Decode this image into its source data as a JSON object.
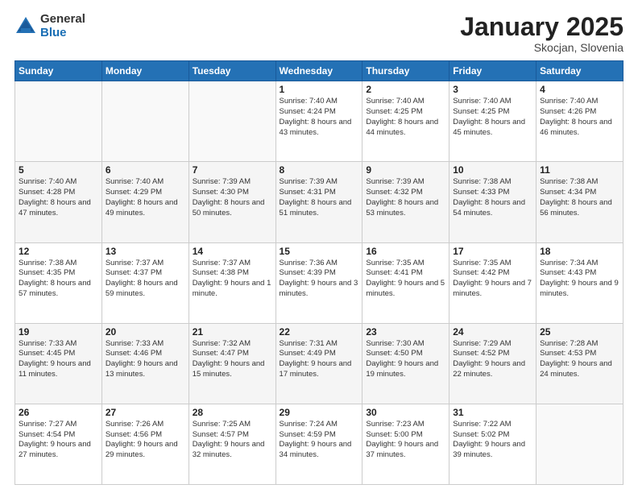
{
  "logo": {
    "general": "General",
    "blue": "Blue"
  },
  "header": {
    "month": "January 2025",
    "location": "Skocjan, Slovenia"
  },
  "weekdays": [
    "Sunday",
    "Monday",
    "Tuesday",
    "Wednesday",
    "Thursday",
    "Friday",
    "Saturday"
  ],
  "weeks": [
    [
      {
        "day": "",
        "info": ""
      },
      {
        "day": "",
        "info": ""
      },
      {
        "day": "",
        "info": ""
      },
      {
        "day": "1",
        "info": "Sunrise: 7:40 AM\nSunset: 4:24 PM\nDaylight: 8 hours and 43 minutes."
      },
      {
        "day": "2",
        "info": "Sunrise: 7:40 AM\nSunset: 4:25 PM\nDaylight: 8 hours and 44 minutes."
      },
      {
        "day": "3",
        "info": "Sunrise: 7:40 AM\nSunset: 4:25 PM\nDaylight: 8 hours and 45 minutes."
      },
      {
        "day": "4",
        "info": "Sunrise: 7:40 AM\nSunset: 4:26 PM\nDaylight: 8 hours and 46 minutes."
      }
    ],
    [
      {
        "day": "5",
        "info": "Sunrise: 7:40 AM\nSunset: 4:28 PM\nDaylight: 8 hours and 47 minutes."
      },
      {
        "day": "6",
        "info": "Sunrise: 7:40 AM\nSunset: 4:29 PM\nDaylight: 8 hours and 49 minutes."
      },
      {
        "day": "7",
        "info": "Sunrise: 7:39 AM\nSunset: 4:30 PM\nDaylight: 8 hours and 50 minutes."
      },
      {
        "day": "8",
        "info": "Sunrise: 7:39 AM\nSunset: 4:31 PM\nDaylight: 8 hours and 51 minutes."
      },
      {
        "day": "9",
        "info": "Sunrise: 7:39 AM\nSunset: 4:32 PM\nDaylight: 8 hours and 53 minutes."
      },
      {
        "day": "10",
        "info": "Sunrise: 7:38 AM\nSunset: 4:33 PM\nDaylight: 8 hours and 54 minutes."
      },
      {
        "day": "11",
        "info": "Sunrise: 7:38 AM\nSunset: 4:34 PM\nDaylight: 8 hours and 56 minutes."
      }
    ],
    [
      {
        "day": "12",
        "info": "Sunrise: 7:38 AM\nSunset: 4:35 PM\nDaylight: 8 hours and 57 minutes."
      },
      {
        "day": "13",
        "info": "Sunrise: 7:37 AM\nSunset: 4:37 PM\nDaylight: 8 hours and 59 minutes."
      },
      {
        "day": "14",
        "info": "Sunrise: 7:37 AM\nSunset: 4:38 PM\nDaylight: 9 hours and 1 minute."
      },
      {
        "day": "15",
        "info": "Sunrise: 7:36 AM\nSunset: 4:39 PM\nDaylight: 9 hours and 3 minutes."
      },
      {
        "day": "16",
        "info": "Sunrise: 7:35 AM\nSunset: 4:41 PM\nDaylight: 9 hours and 5 minutes."
      },
      {
        "day": "17",
        "info": "Sunrise: 7:35 AM\nSunset: 4:42 PM\nDaylight: 9 hours and 7 minutes."
      },
      {
        "day": "18",
        "info": "Sunrise: 7:34 AM\nSunset: 4:43 PM\nDaylight: 9 hours and 9 minutes."
      }
    ],
    [
      {
        "day": "19",
        "info": "Sunrise: 7:33 AM\nSunset: 4:45 PM\nDaylight: 9 hours and 11 minutes."
      },
      {
        "day": "20",
        "info": "Sunrise: 7:33 AM\nSunset: 4:46 PM\nDaylight: 9 hours and 13 minutes."
      },
      {
        "day": "21",
        "info": "Sunrise: 7:32 AM\nSunset: 4:47 PM\nDaylight: 9 hours and 15 minutes."
      },
      {
        "day": "22",
        "info": "Sunrise: 7:31 AM\nSunset: 4:49 PM\nDaylight: 9 hours and 17 minutes."
      },
      {
        "day": "23",
        "info": "Sunrise: 7:30 AM\nSunset: 4:50 PM\nDaylight: 9 hours and 19 minutes."
      },
      {
        "day": "24",
        "info": "Sunrise: 7:29 AM\nSunset: 4:52 PM\nDaylight: 9 hours and 22 minutes."
      },
      {
        "day": "25",
        "info": "Sunrise: 7:28 AM\nSunset: 4:53 PM\nDaylight: 9 hours and 24 minutes."
      }
    ],
    [
      {
        "day": "26",
        "info": "Sunrise: 7:27 AM\nSunset: 4:54 PM\nDaylight: 9 hours and 27 minutes."
      },
      {
        "day": "27",
        "info": "Sunrise: 7:26 AM\nSunset: 4:56 PM\nDaylight: 9 hours and 29 minutes."
      },
      {
        "day": "28",
        "info": "Sunrise: 7:25 AM\nSunset: 4:57 PM\nDaylight: 9 hours and 32 minutes."
      },
      {
        "day": "29",
        "info": "Sunrise: 7:24 AM\nSunset: 4:59 PM\nDaylight: 9 hours and 34 minutes."
      },
      {
        "day": "30",
        "info": "Sunrise: 7:23 AM\nSunset: 5:00 PM\nDaylight: 9 hours and 37 minutes."
      },
      {
        "day": "31",
        "info": "Sunrise: 7:22 AM\nSunset: 5:02 PM\nDaylight: 9 hours and 39 minutes."
      },
      {
        "day": "",
        "info": ""
      }
    ]
  ]
}
